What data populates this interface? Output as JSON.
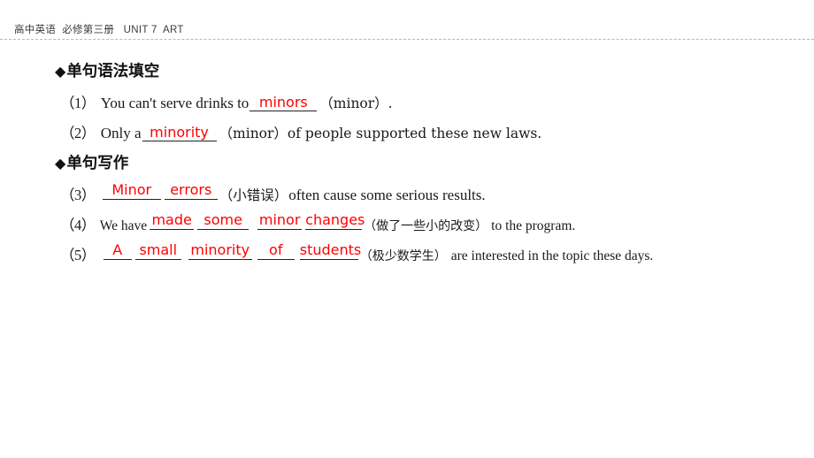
{
  "header": {
    "title": "高中英语  必修第三册   UNIT 7  ART"
  },
  "sections": [
    {
      "bullet": "◆",
      "label": "单句语法填空"
    },
    {
      "bullet": "◆",
      "label": "单句写作"
    }
  ],
  "questions": {
    "q1": {
      "number": "（1）",
      "before": "You can't serve drinks to",
      "answer": "minors",
      "after": "（minor）.",
      "hint": ""
    },
    "q2": {
      "number": "（2）",
      "before": "Only a",
      "answer": "minority",
      "after": "（minor）of people supported these new laws.",
      "hint": ""
    },
    "q3": {
      "number": "（3）",
      "answers": [
        "Minor",
        "errors"
      ],
      "hint": "（小错误）",
      "after": "often cause some serious results."
    },
    "q4": {
      "number": "（4）",
      "before": "We have",
      "answers": [
        "made",
        "some",
        "minor",
        "changes"
      ],
      "hint": "（做了一些小的改变）",
      "after": "to the program."
    },
    "q5": {
      "number": "（5）",
      "answers": [
        "A",
        "small",
        "minority",
        "of",
        "students"
      ],
      "hint": "（极少数学生）",
      "after": "are interested in the topic these days."
    }
  },
  "colors": {
    "answer_red": "#ff0000",
    "rule_blue": "#aab8dd",
    "text_black": "#1a1a1a"
  }
}
